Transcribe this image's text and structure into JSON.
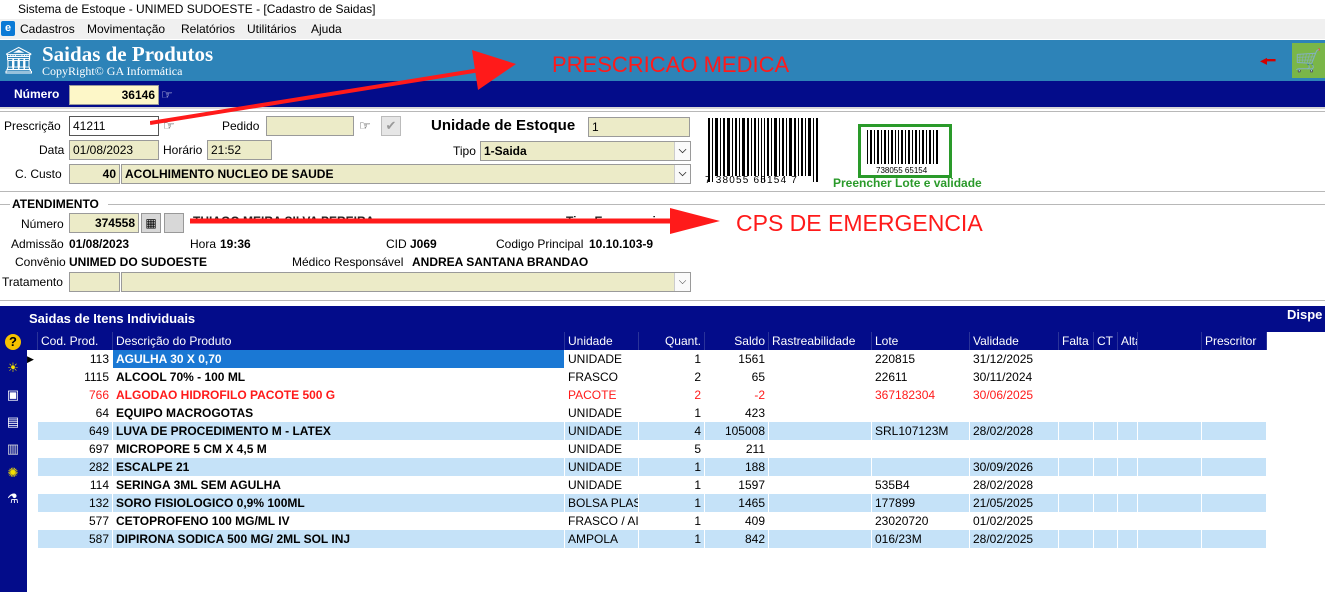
{
  "window": {
    "title": "Sistema de Estoque - UNIMED SUDOESTE - [Cadastro de Saidas]"
  },
  "menu": [
    "Cadastros",
    "Movimentação",
    "Relatórios",
    "Utilitários",
    "Ajuda"
  ],
  "header": {
    "title": "Saidas de Produtos",
    "copyright": "CopyRight© GA Informática"
  },
  "annotations": {
    "prescricao": "PRESCRICAO MEDICA",
    "cps": "CPS DE EMERGENCIA"
  },
  "numero": {
    "label": "Número",
    "value": "36146"
  },
  "form": {
    "prescricao_label": "Prescrição",
    "prescricao_value": "41211",
    "pedido_label": "Pedido",
    "pedido_value": "",
    "unidade_label": "Unidade de Estoque",
    "unidade_value": "1",
    "data_label": "Data",
    "data_value": "01/08/2023",
    "horario_label": "Horário",
    "horario_value": "21:52",
    "tipo_label": "Tipo",
    "tipo_value": "1-Saida",
    "custo_label": "C. Custo",
    "custo_code": "40",
    "custo_name": "ACOLHIMENTO NUCLEO DE SAUDE",
    "barcode_number": "7 38055 65154 7",
    "barcode_small_number": "738055 65154",
    "lote_hint": "Preencher Lote e validade"
  },
  "atendimento": {
    "section_label": "ATENDIMENTO",
    "numero_label": "Número",
    "numero_value": "374558",
    "patient_name": "THIAGO MEIRA SILVA PEREIRA",
    "tipo_text": "Tipo Emergencia",
    "admissao_label": "Admissão",
    "admissao_value": "01/08/2023",
    "hora_label": "Hora",
    "hora_value": "19:36",
    "cid_label": "CID",
    "cid_value": "J069",
    "codigo_label": "Codigo Principal",
    "codigo_value": "10.10.103-9",
    "convenio_label": "Convênio",
    "convenio_value": "UNIMED DO SUDOESTE",
    "medico_label": "Médico Responsável",
    "medico_value": "ANDREA SANTANA BRANDAO",
    "tratamento_label": "Tratamento",
    "tratamento_code": "",
    "tratamento_value": ""
  },
  "grid": {
    "section_label": "Saidas de Itens Individuais",
    "right_label": "Dispe",
    "columns": [
      "Cod. Prod.",
      "Descrição do Produto",
      "Unidade",
      "Quant.",
      "Saldo",
      "Rastreabilidade",
      "Lote",
      "Validade",
      "Falta",
      "CT",
      "Alta",
      "",
      "Prescritor"
    ],
    "rows": [
      {
        "cod": "113",
        "desc": "AGULHA 30 X 0,70",
        "unidade": "UNIDADE",
        "quant": "1",
        "saldo": "1561",
        "rastreabilidade": "",
        "lote": "220815",
        "validade": "31/12/2025",
        "style": "selected"
      },
      {
        "cod": "1115",
        "desc": "ALCOOL 70% - 100 ML",
        "unidade": "FRASCO",
        "quant": "2",
        "saldo": "65",
        "rastreabilidade": "",
        "lote": "22611",
        "validade": "30/11/2024",
        "style": "white"
      },
      {
        "cod": "766",
        "desc": "ALGODAO HIDROFILO PACOTE 500 G",
        "unidade": "PACOTE",
        "quant": "2",
        "saldo": "-2",
        "rastreabilidade": "",
        "lote": "367182304",
        "validade": "30/06/2025",
        "style": "red"
      },
      {
        "cod": "64",
        "desc": "EQUIPO MACROGOTAS",
        "unidade": "UNIDADE",
        "quant": "1",
        "saldo": "423",
        "rastreabilidade": "",
        "lote": "",
        "validade": "",
        "style": "white"
      },
      {
        "cod": "649",
        "desc": "LUVA DE PROCEDIMENTO M - LATEX",
        "unidade": "UNIDADE",
        "quant": "4",
        "saldo": "105008",
        "rastreabilidade": "",
        "lote": "SRL107123M",
        "validade": "28/02/2028",
        "style": "blue"
      },
      {
        "cod": "697",
        "desc": "MICROPORE  5 CM X 4,5 M",
        "unidade": "UNIDADE",
        "quant": "5",
        "saldo": "211",
        "rastreabilidade": "",
        "lote": "",
        "validade": "",
        "style": "white"
      },
      {
        "cod": "282",
        "desc": "ESCALPE 21",
        "unidade": "UNIDADE",
        "quant": "1",
        "saldo": "188",
        "rastreabilidade": "",
        "lote": "",
        "validade": "30/09/2026",
        "style": "blue"
      },
      {
        "cod": "114",
        "desc": "SERINGA 3ML SEM AGULHA",
        "unidade": "UNIDADE",
        "quant": "1",
        "saldo": "1597",
        "rastreabilidade": "",
        "lote": "535B4",
        "validade": "28/02/2028",
        "style": "white"
      },
      {
        "cod": "132",
        "desc": "SORO FISIOLOGICO 0,9% 100ML",
        "unidade": "BOLSA PLAS",
        "quant": "1",
        "saldo": "1465",
        "rastreabilidade": "",
        "lote": "177899",
        "validade": "21/05/2025",
        "style": "blue"
      },
      {
        "cod": "577",
        "desc": "CETOPROFENO 100 MG/ML IV",
        "unidade": "FRASCO / AI",
        "quant": "1",
        "saldo": "409",
        "rastreabilidade": "",
        "lote": "23020720",
        "validade": "01/02/2025",
        "style": "white"
      },
      {
        "cod": "587",
        "desc": "DIPIRONA SODICA 500 MG/ 2ML SOL INJ",
        "unidade": "AMPOLA",
        "quant": "1",
        "saldo": "842",
        "rastreabilidade": "",
        "lote": "016/23M",
        "validade": "28/02/2025",
        "style": "blue"
      }
    ]
  },
  "icons": [
    "building-icon",
    "pointing-hand-icon",
    "checkmark-icon",
    "back-arrow-icon",
    "cart-icon",
    "calculator-icon",
    "help-icon",
    "sun-icon",
    "save-icon",
    "clipboard-icon",
    "trash-icon",
    "gear-icon",
    "flask-icon"
  ],
  "colors": {
    "header_blue": "#2d83b8",
    "nav_navy": "#030c8a",
    "field_bg": "#ecebc8",
    "row_blue": "#c5e2f8",
    "selected_blue": "#1a78d4",
    "annotation_red": "#ff1a1a",
    "hint_green": "#2a9a2a"
  }
}
